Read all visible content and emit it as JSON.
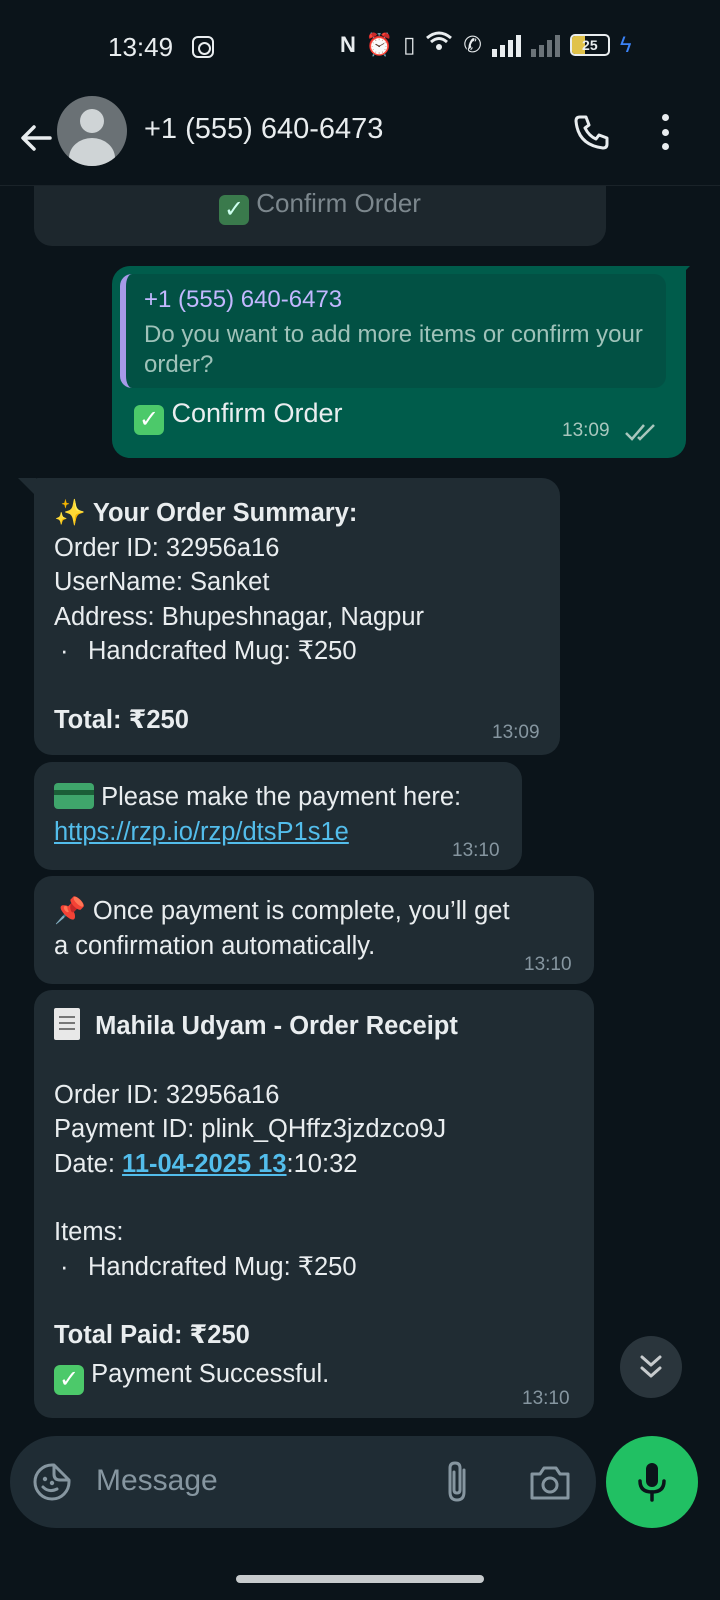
{
  "status_bar": {
    "time": "13:49",
    "battery_level": "25"
  },
  "header": {
    "contact_name": "+1 (555) 640-6473"
  },
  "messages": {
    "partial_button": {
      "icon": "check-mark-button-emoji",
      "label": "Confirm Order"
    },
    "reply": {
      "quoted_name": "+1 (555) 640-6473",
      "quoted_text": "Do you want to add more items or confirm your order?",
      "button_icon": "check-mark-button-emoji",
      "button_label": "Confirm Order",
      "time": "13:09"
    },
    "order_summary": {
      "emoji": "✨",
      "title": "Your Order Summary:",
      "order_id": "Order ID: 32956a16",
      "username": "UserName: Sanket",
      "address": "Address: Bhupeshnagar, Nagpur",
      "item": "Handcrafted Mug: ₹250",
      "total": "Total: ₹250",
      "time": "13:09"
    },
    "payment": {
      "emoji": "💳",
      "text": "Please make the payment here:",
      "link": "https://rzp.io/rzp/dtsP1s1e",
      "time": "13:10"
    },
    "notice": {
      "emoji": "📌",
      "line1": "Once payment is complete, you’ll get",
      "line2": "a confirmation automatically.",
      "time": "13:10"
    },
    "receipt": {
      "emoji": "🧾",
      "title": "Mahila Udyam - Order Receipt",
      "order_id": "Order ID: 32956a16",
      "payment_id": "Payment ID: plink_QHffz3jzdzco9J",
      "date_label": "Date: ",
      "date_link": "11-04-2025 13",
      "date_rest": ":10:32",
      "items_label": "Items:",
      "item": "Handcrafted Mug: ₹250",
      "total_paid": "Total Paid: ₹250",
      "status": "Payment Successful.",
      "time": "13:10"
    }
  },
  "input": {
    "placeholder": "Message"
  },
  "colors": {
    "background": "#0b141a",
    "incoming_bubble": "#202c33",
    "outgoing_bubble": "#005c4b",
    "link": "#53bdeb",
    "mic_button": "#21c063"
  }
}
